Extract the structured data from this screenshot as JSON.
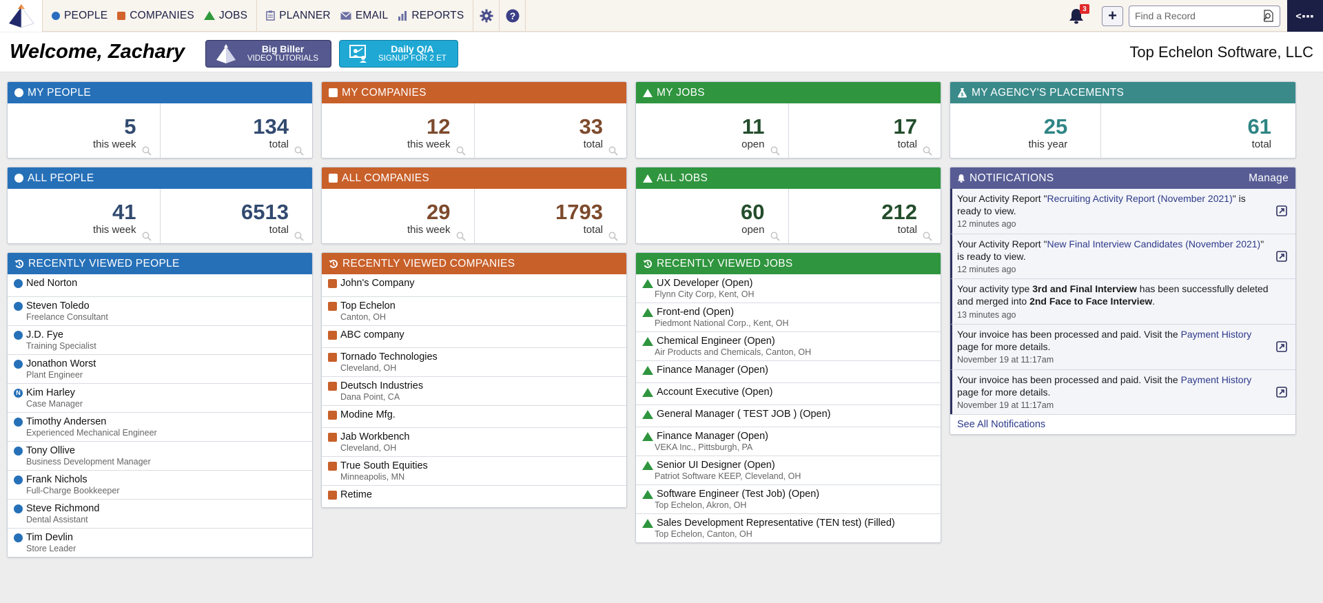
{
  "nav": {
    "items": [
      {
        "label": "PEOPLE",
        "icon": "people-dot-icon"
      },
      {
        "label": "COMPANIES",
        "icon": "companies-square-icon"
      },
      {
        "label": "JOBS",
        "icon": "jobs-triangle-icon"
      },
      {
        "label": "PLANNER",
        "icon": "planner-icon"
      },
      {
        "label": "EMAIL",
        "icon": "email-icon"
      },
      {
        "label": "REPORTS",
        "icon": "reports-icon"
      }
    ],
    "notification_count": "3",
    "add_label": "+",
    "search_placeholder": "Find a Record",
    "collapse_label": "<▪▪▪"
  },
  "header": {
    "welcome": "Welcome, Zachary",
    "promo_biller": {
      "title": "Big Biller",
      "subtitle": "VIDEO TUTORIALS"
    },
    "promo_qa": {
      "title": "Daily Q/A",
      "subtitle": "SIGNUP FOR 2 ET"
    },
    "company": "Top Echelon Software, LLC"
  },
  "colors": {
    "people": "#2670b8",
    "companies": "#c8602a",
    "jobs": "#2f953e",
    "placements": "#3a8a8a",
    "notifications": "#575c94",
    "nav_dark": "#1b1f45"
  },
  "stats": {
    "my_people": {
      "title": "MY PEOPLE",
      "a": {
        "value": "5",
        "label": "this week"
      },
      "b": {
        "value": "134",
        "label": "total"
      }
    },
    "all_people": {
      "title": "ALL PEOPLE",
      "a": {
        "value": "41",
        "label": "this week"
      },
      "b": {
        "value": "6513",
        "label": "total"
      }
    },
    "my_companies": {
      "title": "MY COMPANIES",
      "a": {
        "value": "12",
        "label": "this week"
      },
      "b": {
        "value": "33",
        "label": "total"
      }
    },
    "all_companies": {
      "title": "ALL COMPANIES",
      "a": {
        "value": "29",
        "label": "this week"
      },
      "b": {
        "value": "1793",
        "label": "total"
      }
    },
    "my_jobs": {
      "title": "MY JOBS",
      "a": {
        "value": "11",
        "label": "open"
      },
      "b": {
        "value": "17",
        "label": "total"
      }
    },
    "all_jobs": {
      "title": "ALL JOBS",
      "a": {
        "value": "60",
        "label": "open"
      },
      "b": {
        "value": "212",
        "label": "total"
      }
    },
    "placements": {
      "title": "MY AGENCY'S PLACEMENTS",
      "a": {
        "value": "25",
        "label": "this year"
      },
      "b": {
        "value": "61",
        "label": "total"
      }
    }
  },
  "recent_people": {
    "title": "RECENTLY VIEWED PEOPLE",
    "items": [
      {
        "name": "Ned Norton",
        "sub": "",
        "icon": "dot"
      },
      {
        "name": "Steven Toledo",
        "sub": "Freelance Consultant",
        "icon": "dot"
      },
      {
        "name": "J.D. Fye",
        "sub": "Training Specialist",
        "icon": "dot"
      },
      {
        "name": "Jonathon Worst",
        "sub": "Plant Engineer",
        "icon": "dot"
      },
      {
        "name": "Kim Harley",
        "sub": "Case Manager",
        "icon": "n"
      },
      {
        "name": "Timothy Andersen",
        "sub": "Experienced Mechanical Engineer",
        "icon": "dot"
      },
      {
        "name": "Tony Ollive",
        "sub": "Business Development Manager",
        "icon": "dot"
      },
      {
        "name": "Frank Nichols",
        "sub": "Full-Charge Bookkeeper",
        "icon": "dot"
      },
      {
        "name": "Steve Richmond",
        "sub": "Dental Assistant",
        "icon": "dot"
      },
      {
        "name": "Tim Devlin",
        "sub": "Store Leader",
        "icon": "dot"
      }
    ]
  },
  "recent_companies": {
    "title": "RECENTLY VIEWED COMPANIES",
    "items": [
      {
        "name": "John's Company",
        "sub": ""
      },
      {
        "name": "Top Echelon",
        "sub": "Canton, OH"
      },
      {
        "name": "ABC company",
        "sub": ""
      },
      {
        "name": "Tornado Technologies",
        "sub": "Cleveland, OH"
      },
      {
        "name": "Deutsch Industries",
        "sub": "Dana Point, CA"
      },
      {
        "name": "Modine Mfg.",
        "sub": ""
      },
      {
        "name": "Jab Workbench",
        "sub": "Cleveland, OH"
      },
      {
        "name": "True South Equities",
        "sub": "Minneapolis, MN"
      },
      {
        "name": "Retime",
        "sub": ""
      }
    ]
  },
  "recent_jobs": {
    "title": "RECENTLY VIEWED JOBS",
    "items": [
      {
        "name": "UX Developer (Open)",
        "sub": "Flynn City Corp, Kent, OH"
      },
      {
        "name": "Front-end (Open)",
        "sub": "Piedmont National Corp., Kent, OH"
      },
      {
        "name": "Chemical Engineer (Open)",
        "sub": "Air Products and Chemicals, Canton, OH"
      },
      {
        "name": "Finance Manager (Open)",
        "sub": ""
      },
      {
        "name": "Account Executive (Open)",
        "sub": ""
      },
      {
        "name": "General Manager ( TEST JOB ) (Open)",
        "sub": ""
      },
      {
        "name": "Finance Manager (Open)",
        "sub": "VEKA Inc., Pittsburgh, PA"
      },
      {
        "name": "Senior UI Designer (Open)",
        "sub": "Patriot Software KEEP, Cleveland, OH"
      },
      {
        "name": "Software Engineer (Test Job) (Open)",
        "sub": "Top Echelon, Akron, OH"
      },
      {
        "name": "Sales Development Representative (TEN test) (Filled)",
        "sub": "Top Echelon, Canton, OH"
      }
    ]
  },
  "notifications": {
    "title": "NOTIFICATIONS",
    "manage_label": "Manage",
    "see_all_label": "See All Notifications",
    "items": [
      {
        "pre": "Your Activity Report \"",
        "link": "Recruiting Activity Report (November 2021)",
        "post": "\" is ready to view.",
        "time": "12 minutes ago",
        "has_link": true
      },
      {
        "pre": "Your Activity Report \"",
        "link": "New Final Interview Candidates (November 2021)",
        "post": "\" is ready to view.",
        "time": "12 minutes ago",
        "has_link": true
      },
      {
        "pre": "Your activity type ",
        "bold1": "3rd and Final Interview",
        "mid": " has been successfully deleted and merged into ",
        "bold2": "2nd Face to Face Interview",
        "post": ".",
        "time": "13 minutes ago",
        "has_link": false
      },
      {
        "pre": "Your invoice has been processed and paid. Visit the ",
        "link": "Payment History",
        "post": " page for more details.",
        "time": "November 19 at 11:17am",
        "has_link": true
      },
      {
        "pre": "Your invoice has been processed and paid. Visit the ",
        "link": "Payment History",
        "post": " page for more details.",
        "time": "November 19 at 11:17am",
        "has_link": true
      }
    ]
  }
}
